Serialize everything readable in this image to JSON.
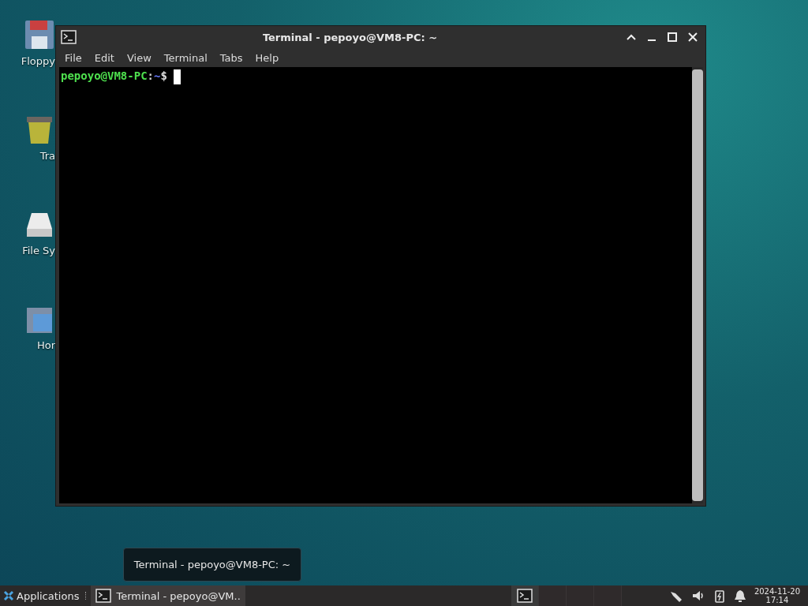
{
  "desktop_icons": [
    {
      "kind": "floppy",
      "label": "Floppy"
    },
    {
      "kind": "trash",
      "label": "Tra"
    },
    {
      "kind": "drive",
      "label": "File Sy"
    },
    {
      "kind": "home",
      "label": "Hor"
    }
  ],
  "window": {
    "title": "Terminal - pepoyo@VM8-PC: ~",
    "menu": [
      "File",
      "Edit",
      "View",
      "Terminal",
      "Tabs",
      "Help"
    ],
    "prompt": {
      "user_host": "pepoyo@VM8-PC",
      "separator": ":",
      "path": "~",
      "symbol": "$"
    }
  },
  "tooltip": "Terminal - pepoyo@VM8-PC: ~",
  "taskbar": {
    "applications": "Applications",
    "tasks": [
      {
        "label": "Terminal - pepoyo@VM..",
        "selected": true
      }
    ],
    "workspaces": [
      {
        "selected": true
      },
      {
        "selected": false
      },
      {
        "selected": false
      },
      {
        "selected": false
      }
    ],
    "clock": {
      "date": "2024-11-20",
      "time": "17:14"
    }
  }
}
